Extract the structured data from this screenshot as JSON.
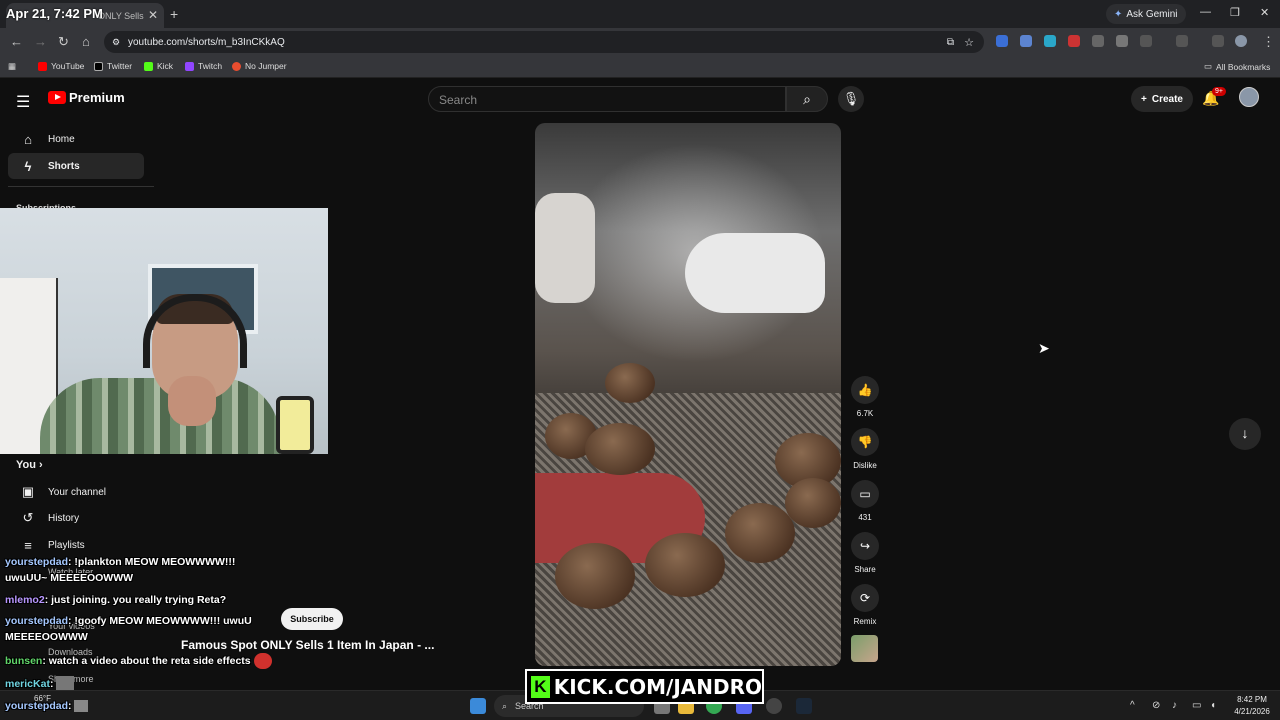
{
  "browser": {
    "tab_timestamp": "Apr 21, 7:42 PM",
    "tab_title": "ONLY Sells",
    "ask_gemini": "Ask Gemini",
    "url": "youtube.com/shorts/m_b3InCKkAQ",
    "bookmarks": [
      "YouTube",
      "Twitter",
      "Kick",
      "Twitch",
      "No Jumper"
    ],
    "all_bookmarks": "All Bookmarks"
  },
  "youtube": {
    "logo_text": "Premium",
    "search_placeholder": "Search",
    "create_label": "Create",
    "notif_badge": "9+",
    "sidebar": {
      "home": "Home",
      "shorts": "Shorts",
      "subscriptions": "Subscriptions",
      "you": "You",
      "your_channel": "Your channel",
      "history": "History",
      "playlists": "Playlists",
      "watch_later": "Watch later",
      "your_videos": "Your videos",
      "downloads": "Downloads",
      "show_more": "Show more"
    },
    "actions": {
      "likes": "6.7K",
      "dislike": "Dislike",
      "comments": "431",
      "share": "Share",
      "remix": "Remix"
    },
    "subscribe": "Subscribe",
    "video_title": "Famous Spot ONLY Sells 1 Item In Japan - ..."
  },
  "chat": [
    {
      "user": "yourstepdad",
      "msg": ": !plankton MEOW MEOWWWW!!!"
    },
    {
      "user": "",
      "msg": "uwuUU~ MEEEEOOWWW"
    },
    {
      "user": "mlemo2",
      "msg": ": just joining. you really trying Reta?"
    },
    {
      "user": "yourstepdad",
      "msg": ": !goofy MEOW MEOWWWW!!! uwuU"
    },
    {
      "user": "",
      "msg": "MEEEEOOWWW"
    },
    {
      "user": "bunsen",
      "msg": ": watch a video about the reta side effects"
    },
    {
      "user": "mericKat",
      "msg": ":"
    },
    {
      "user": "yourstepdad",
      "msg": ":"
    }
  ],
  "overlay": {
    "kick_url": "KICK.COM/JANDRO"
  },
  "taskbar": {
    "search": "Search",
    "time": "8:42 PM",
    "date": "4/21/2026",
    "weather": "66°F"
  },
  "colors": {
    "youtube_red": "#ff0000",
    "kick_green": "#53fc18",
    "active_bg": "#272727"
  }
}
